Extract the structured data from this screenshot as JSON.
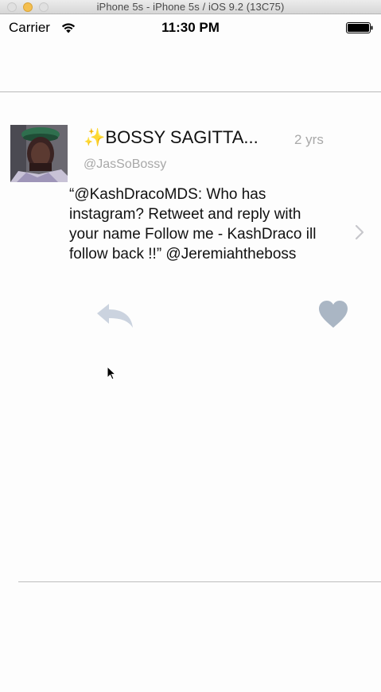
{
  "window": {
    "title": "iPhone 5s - iPhone 5s / iOS 9.2 (13C75)"
  },
  "status_bar": {
    "carrier": "Carrier",
    "time": "11:30 PM",
    "icons": [
      "wifi-icon",
      "battery-icon"
    ]
  },
  "tweet": {
    "author_name": "✨BOSSY SAGITTA...",
    "timestamp": "2 yrs",
    "handle": "@JasSoBossy",
    "text": "“@KashDracoMDS: Who has instagram? Retweet and reply with your name Follow me - KashDraco ill follow back !!” @Jeremiahtheboss",
    "actions": [
      "reply-icon",
      "like-icon"
    ],
    "colors": {
      "reply_icon": "#cbd3df",
      "like_icon": "#aab6c4",
      "secondary_text": "#a8a8a8"
    }
  }
}
